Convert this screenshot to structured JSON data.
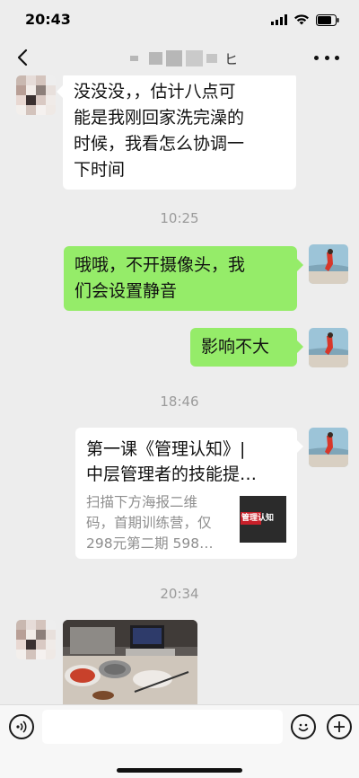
{
  "status": {
    "time": "20:43"
  },
  "nav": {
    "title_glyph": "ヒ"
  },
  "messages": {
    "m1": {
      "text": "没没没，，估计八点可\n能是我刚回家洗完澡的\n时候，我看怎么协调一\n下时间"
    },
    "ts1": "10:25",
    "m2": {
      "text": "哦哦，不开摄像头，我\n们会设置静音"
    },
    "m3": {
      "text": "影响不大"
    },
    "ts2": "18:46",
    "link": {
      "title": "第一课《管理认知》|\n中层管理者的技能提…",
      "desc": "扫描下方海报二维\n码，首期训练营，仅\n298元第二期 598…",
      "thumb_label": "管理认知"
    },
    "ts3": "20:34"
  },
  "colors": {
    "self_bubble": "#95ec69",
    "other_bubble": "#ffffff",
    "background": "#ededed"
  },
  "icons": [
    "back-icon",
    "more-icon",
    "voice-icon",
    "emoji-icon",
    "plus-icon",
    "wifi-icon",
    "signal-icon",
    "battery-icon"
  ]
}
